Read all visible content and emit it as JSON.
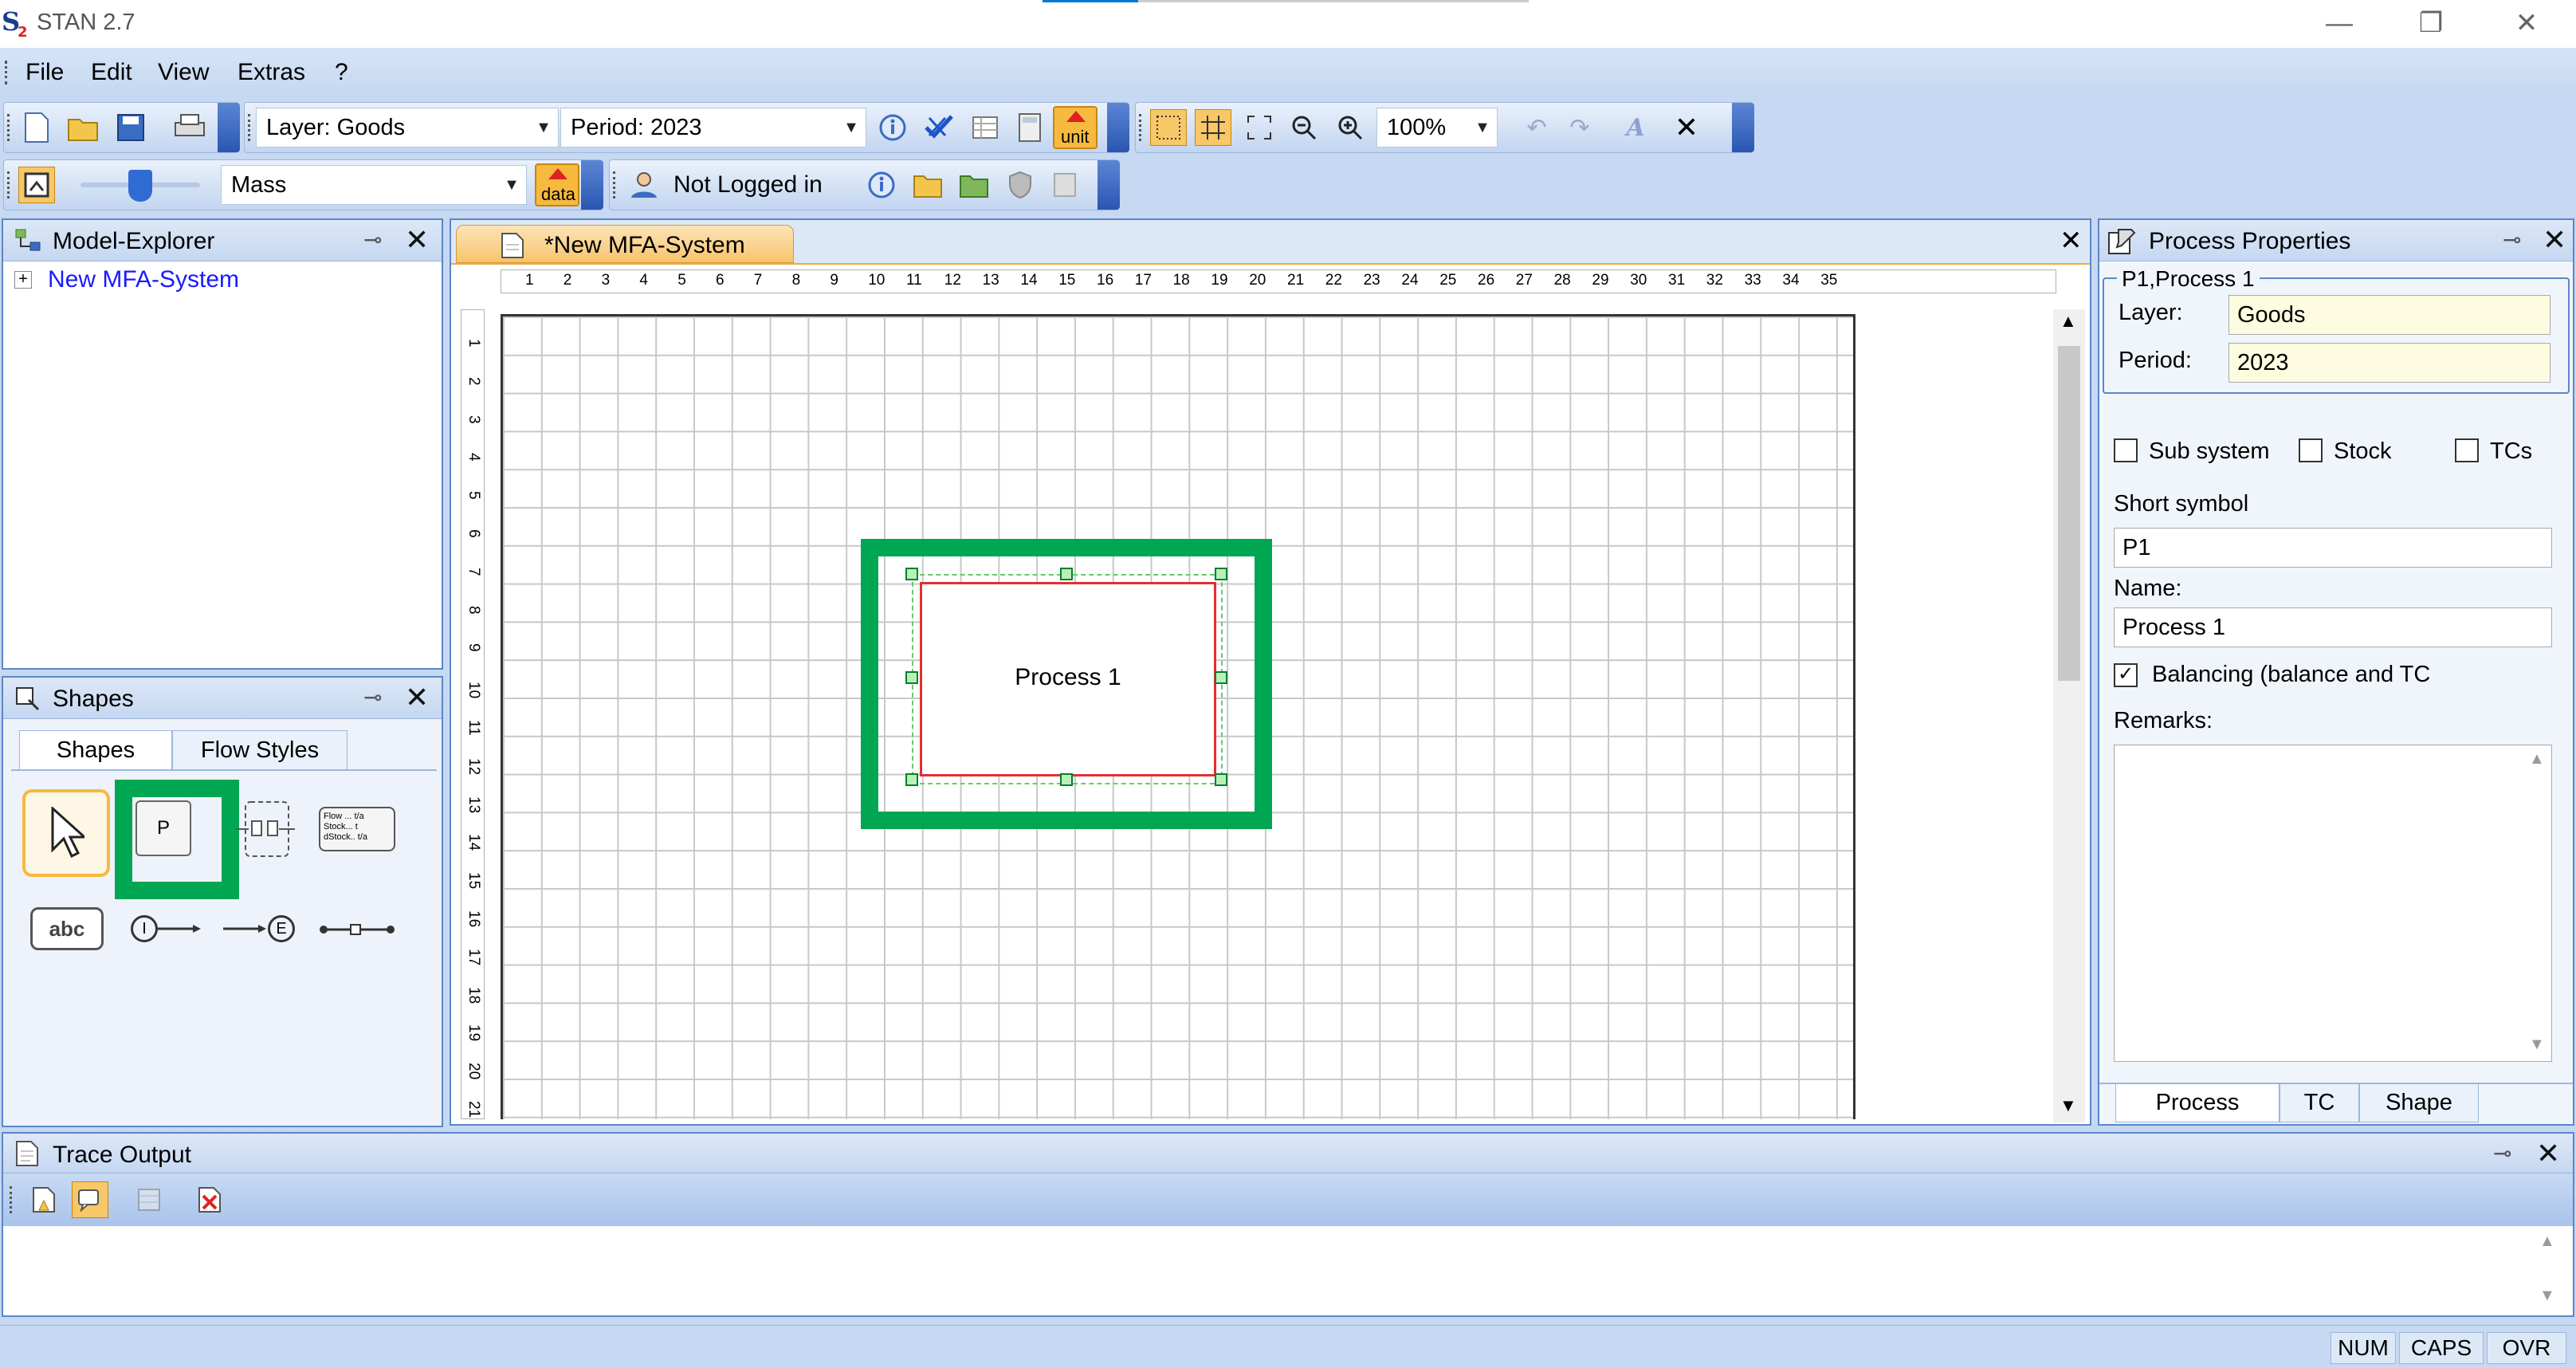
{
  "window": {
    "title": "STAN 2.7",
    "minimize": "—",
    "restore": "❐",
    "close": "✕"
  },
  "menu": {
    "file": "File",
    "edit": "Edit",
    "view": "View",
    "extras": "Extras",
    "help": "?"
  },
  "toolbar1": {
    "layer_combo": "Layer: Goods",
    "period_combo": "Period: 2023",
    "zoom_combo": "100%",
    "unit_label": "unit"
  },
  "toolbar2": {
    "quantity_combo": "Mass",
    "data_label": "data",
    "login_status": "Not Logged in"
  },
  "model_explorer": {
    "title": "Model-Explorer",
    "expand": "+",
    "root_item": "New MFA-System"
  },
  "shapes_panel": {
    "title": "Shapes",
    "tabs": [
      "Shapes",
      "Flow Styles"
    ],
    "process_glyph": "P",
    "text_glyph": "abc",
    "import_glyph": "I",
    "export_glyph": "E",
    "flow_lines": [
      "Flow ... t/a",
      "Stock... t",
      "dStock.. t/a"
    ]
  },
  "document": {
    "tab_label": "*New MFA-System",
    "ruler_top": [
      "1",
      "2",
      "3",
      "4",
      "5",
      "6",
      "7",
      "8",
      "9",
      "10",
      "11",
      "12",
      "13",
      "14",
      "15",
      "16",
      "17",
      "18",
      "19",
      "20",
      "21",
      "22",
      "23",
      "24",
      "25",
      "26",
      "27",
      "28",
      "29",
      "30",
      "31",
      "32",
      "33",
      "34",
      "35"
    ],
    "ruler_left": [
      "1",
      "2",
      "3",
      "4",
      "5",
      "6",
      "7",
      "8",
      "9",
      "10",
      "11",
      "12",
      "13",
      "14",
      "15",
      "16",
      "17",
      "18",
      "19",
      "20",
      "21"
    ],
    "process_label": "Process 1"
  },
  "properties": {
    "title": "Process Properties",
    "group_title": "P1,Process 1",
    "layer_label": "Layer:",
    "layer_value": "Goods",
    "period_label": "Period:",
    "period_value": "2023",
    "subsystem_label": "Sub system",
    "stock_label": "Stock",
    "tcs_label": "TCs",
    "short_symbol_label": "Short symbol",
    "short_symbol_value": "P1",
    "name_label": "Name:",
    "name_value": "Process 1",
    "balancing_label": "Balancing (balance and TC",
    "remarks_label": "Remarks:",
    "tabs": [
      "Process",
      "TC",
      "Shape"
    ]
  },
  "trace": {
    "title": "Trace Output"
  },
  "statusbar": {
    "num": "NUM",
    "caps": "CAPS",
    "ovr": "OVR"
  },
  "colors": {
    "highlight": "#00a651",
    "selection": "#e03030",
    "accent": "#5b87c7",
    "tree_link": "#1a1aff"
  }
}
